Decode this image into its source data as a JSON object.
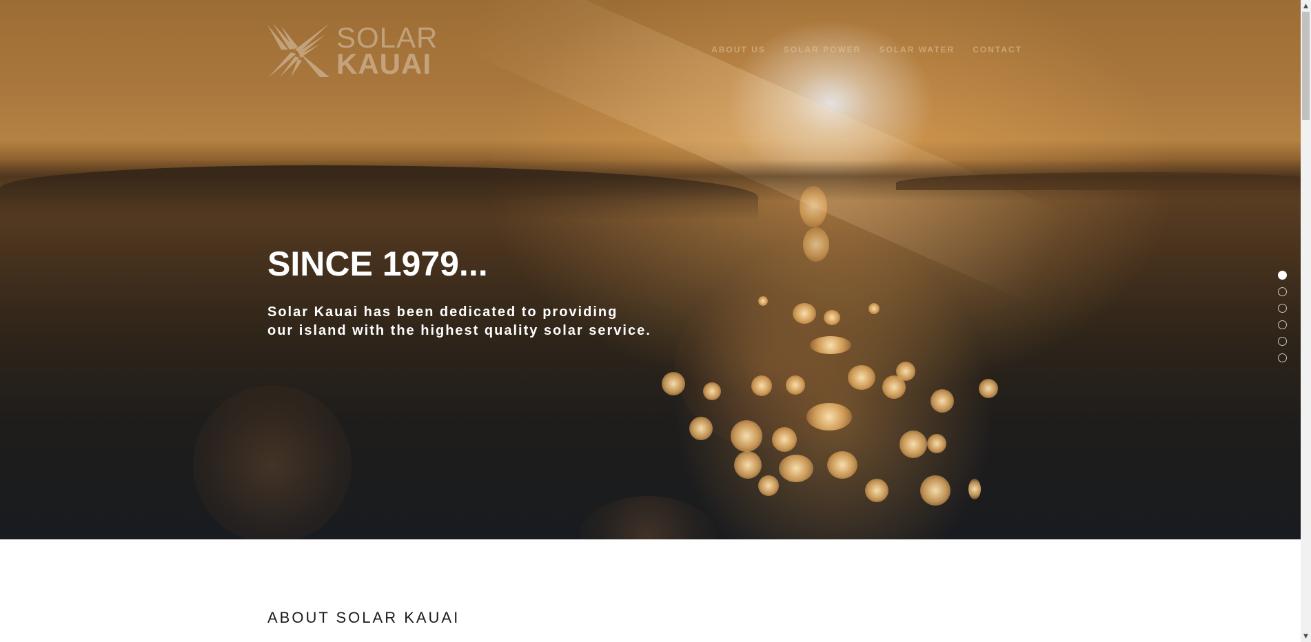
{
  "brand": {
    "line1": "SOLAR",
    "line2": "KAUAI"
  },
  "nav": {
    "items": [
      "ABOUT US",
      "SOLAR POWER",
      "SOLAR WATER",
      "CONTACT"
    ]
  },
  "hero": {
    "title": "SINCE 1979...",
    "text_line1": "Solar Kauai has been dedicated to providing",
    "text_line2": "our island with the highest quality solar service."
  },
  "section_dots": {
    "count": 6,
    "active_index": 0
  },
  "about": {
    "title": "ABOUT SOLAR KAUAI"
  },
  "scrollbar": {
    "up_icon": "▲",
    "down_icon": "▼"
  },
  "colors": {
    "hero_dark": "#181b1f",
    "hero_gold": "#b48242",
    "text": "#ffffff"
  }
}
